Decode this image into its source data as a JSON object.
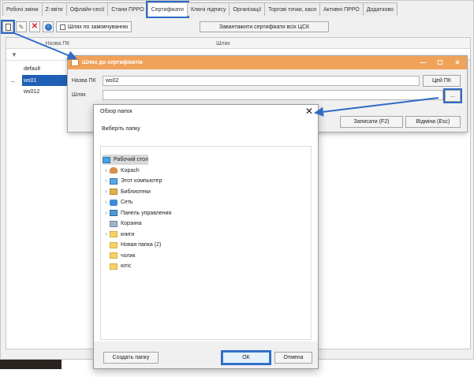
{
  "tabs": [
    {
      "label": "Робочі зміни"
    },
    {
      "label": "Z-звіти"
    },
    {
      "label": "Офлайн-сесії"
    },
    {
      "label": "Стани ПРРО"
    },
    {
      "label": "Сертифікати"
    },
    {
      "label": "Ключі підпису"
    },
    {
      "label": "Організації"
    },
    {
      "label": "Торгові точки, каси"
    },
    {
      "label": "Активні ПРРО"
    },
    {
      "label": "Додатково"
    }
  ],
  "toolbar": {
    "default_path_label": "Шлях по замовчуванню",
    "upload_label": "Завантажити сертифікати всіх ЦСК"
  },
  "grid": {
    "col_name": "Назва ПК",
    "col_path": "Шлях",
    "rows": [
      {
        "name": "default"
      },
      {
        "name": "ws01"
      },
      {
        "name": "ws012"
      }
    ]
  },
  "cert_dialog": {
    "title": "Шлях до сертифікатів",
    "pc_label": "Назва ПК",
    "pc_value": "ws02",
    "this_pc_button": "Цей ПК",
    "path_label": "Шлях",
    "path_value": "",
    "browse_button": "...",
    "save_button": "Записати (F2)",
    "cancel_button": "Відміна (Esc)"
  },
  "folder_dialog": {
    "title": "Обзор папок",
    "prompt": "Виберіть папку",
    "tree": [
      {
        "label": "Рабочий стол",
        "icon": "desktop-icon",
        "level": 0,
        "expander": false,
        "selected": true
      },
      {
        "label": "Kopach",
        "icon": "user-icon",
        "level": 1,
        "expander": true
      },
      {
        "label": "Этот компьютер",
        "icon": "computer-icon",
        "level": 1,
        "expander": true
      },
      {
        "label": "Библиотеки",
        "icon": "library-icon",
        "level": 1,
        "expander": true
      },
      {
        "label": "Сеть",
        "icon": "network-icon",
        "level": 1,
        "expander": true
      },
      {
        "label": "Панель управления",
        "icon": "control-panel-icon",
        "level": 1,
        "expander": true
      },
      {
        "label": "Корзина",
        "icon": "recycle-bin-icon",
        "level": 1,
        "expander": false
      },
      {
        "label": "книги",
        "icon": "folder-icon",
        "level": 1,
        "expander": true
      },
      {
        "label": "Новая папка (2)",
        "icon": "folder-icon",
        "level": 1,
        "expander": false
      },
      {
        "label": "чолик",
        "icon": "folder-icon",
        "level": 1,
        "expander": false
      },
      {
        "label": "ютіс",
        "icon": "folder-icon",
        "level": 1,
        "expander": false
      }
    ],
    "new_folder_button": "Создать папку",
    "ok_button": "ОК",
    "cancel_button": "Отмена"
  },
  "colors": {
    "highlight": "#2e6bc6",
    "dialog_title": "#f0a25a",
    "selection": "#1f5fb5"
  }
}
